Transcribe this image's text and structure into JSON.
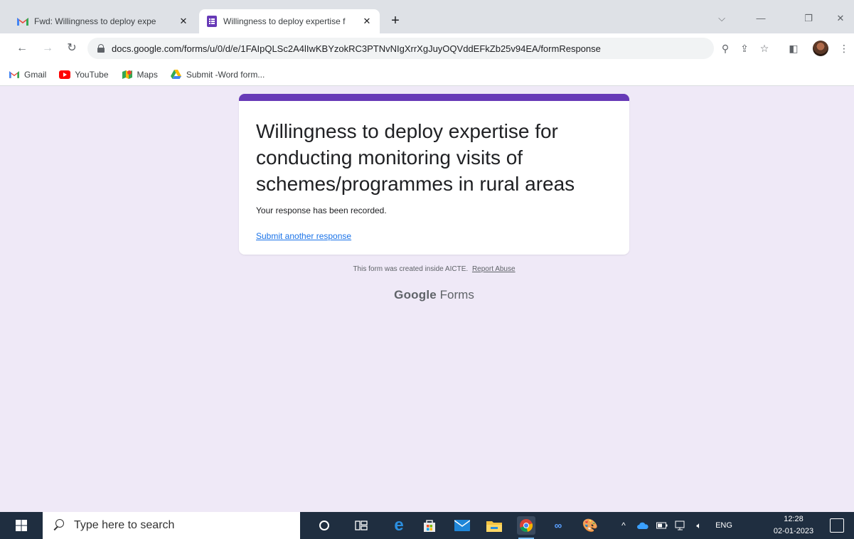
{
  "browser": {
    "tabs": [
      {
        "title": "Fwd: Willingness to deploy expe",
        "favicon": "gmail-icon",
        "active": false
      },
      {
        "title": "Willingness to deploy expertise f",
        "favicon": "google-forms-icon",
        "active": true
      }
    ],
    "address": "docs.google.com/forms/u/0/d/e/1FAIpQLSc2A4lIwKBYzokRC3PTNvNIgXrrXgJuyOQVddEFkZb25v94EA/formResponse",
    "bookmarks": [
      {
        "label": "Gmail",
        "icon": "gmail-icon"
      },
      {
        "label": "YouTube",
        "icon": "youtube-icon"
      },
      {
        "label": "Maps",
        "icon": "maps-icon"
      },
      {
        "label": "Submit -Word form...",
        "icon": "google-drive-icon"
      }
    ]
  },
  "form": {
    "title": "Willingness to deploy expertise for conducting monitoring visits of schemes/programmes in rural areas",
    "confirmation": "Your response has been recorded.",
    "submit_another": "Submit another response",
    "created_note": "This form was created inside AICTE.",
    "report_abuse": "Report Abuse",
    "brand_google": "Google",
    "brand_forms": "Forms",
    "accent_color": "#673ab7"
  },
  "taskbar": {
    "search_placeholder": "Type here to search",
    "language": "ENG",
    "time": "12:28",
    "date": "02-01-2023"
  }
}
